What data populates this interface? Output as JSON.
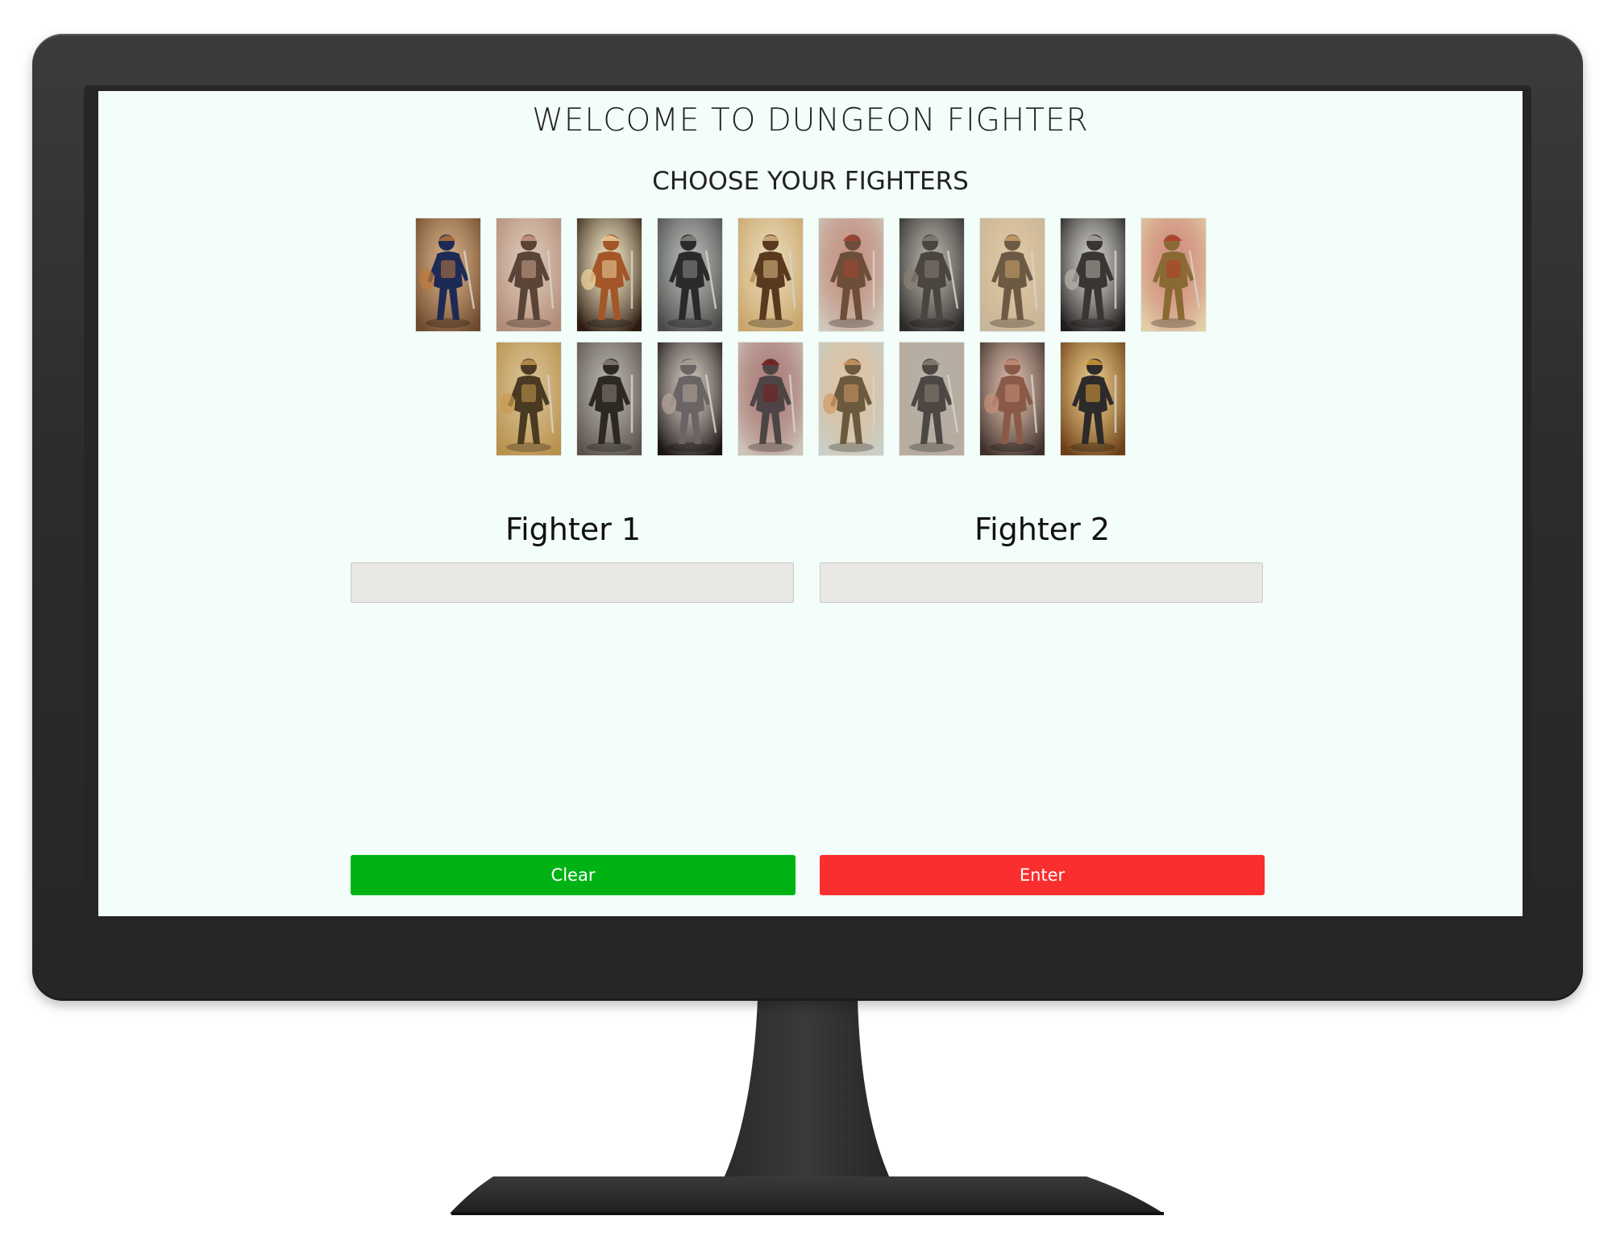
{
  "app": {
    "title": "WELCOME TO DUNGEON FIGHTER",
    "subtitle": "CHOOSE YOUR FIGHTERS"
  },
  "fighters": {
    "row1": [
      {
        "icon": "fighter-portrait-icon",
        "bg": "#6e4a2f",
        "body": "#1d2a55",
        "accent": "#c07a3a"
      },
      {
        "icon": "fighter-portrait-icon",
        "bg": "#b08b77",
        "body": "#5a4438",
        "accent": "#cfa48c"
      },
      {
        "icon": "fighter-portrait-icon",
        "bg": "#2b1a10",
        "body": "#a35628",
        "accent": "#f0d6a0"
      },
      {
        "icon": "fighter-portrait-icon",
        "bg": "#4a4a48",
        "body": "#2a2a2a",
        "accent": "#8c8c88"
      },
      {
        "icon": "fighter-portrait-icon",
        "bg": "#c9a56a",
        "body": "#5a3a1e",
        "accent": "#e0c08a"
      },
      {
        "icon": "fighter-portrait-icon",
        "bg": "#cfc8bb",
        "body": "#6d4e3b",
        "accent": "#a4442e"
      },
      {
        "icon": "fighter-portrait-icon",
        "bg": "#2c2a28",
        "body": "#4b4540",
        "accent": "#8a7f75"
      },
      {
        "icon": "fighter-portrait-icon",
        "bg": "#c8b69a",
        "body": "#6c5a44",
        "accent": "#d2a46c"
      },
      {
        "icon": "fighter-portrait-icon",
        "bg": "#1f1c1b",
        "body": "#3a3634",
        "accent": "#b9b2ac"
      },
      {
        "icon": "fighter-portrait-icon",
        "bg": "#e2cfa8",
        "body": "#8a6a34",
        "accent": "#b83b2b"
      }
    ],
    "row2": [
      {
        "icon": "fighter-portrait-icon",
        "bg": "#b8914d",
        "body": "#4a3a22",
        "accent": "#c79a52"
      },
      {
        "icon": "fighter-portrait-icon",
        "bg": "#5a514a",
        "body": "#2e2824",
        "accent": "#8d8378"
      },
      {
        "icon": "fighter-portrait-icon",
        "bg": "#1b1413",
        "body": "#6a6464",
        "accent": "#b7a59a"
      },
      {
        "icon": "fighter-portrait-icon",
        "bg": "#ccc4b8",
        "body": "#4d4545",
        "accent": "#7a1e1e"
      },
      {
        "icon": "fighter-portrait-icon",
        "bg": "#c9cfc6",
        "body": "#6b5a3e",
        "accent": "#d39a66"
      },
      {
        "icon": "fighter-portrait-icon",
        "bg": "#b9ada0",
        "body": "#4d4744",
        "accent": "#8f7f74"
      },
      {
        "icon": "fighter-portrait-icon",
        "bg": "#3d302b",
        "body": "#8a5a48",
        "accent": "#c89078"
      },
      {
        "icon": "fighter-portrait-icon",
        "bg": "#6a3f18",
        "body": "#2d2a2a",
        "accent": "#e0a33a"
      }
    ]
  },
  "slots": {
    "fighter1_label": "Fighter 1",
    "fighter1_value": "",
    "fighter2_label": "Fighter 2",
    "fighter2_value": ""
  },
  "buttons": {
    "clear_label": "Clear",
    "enter_label": "Enter",
    "clear_color": "#00b315",
    "enter_color": "#fa2e2e"
  }
}
